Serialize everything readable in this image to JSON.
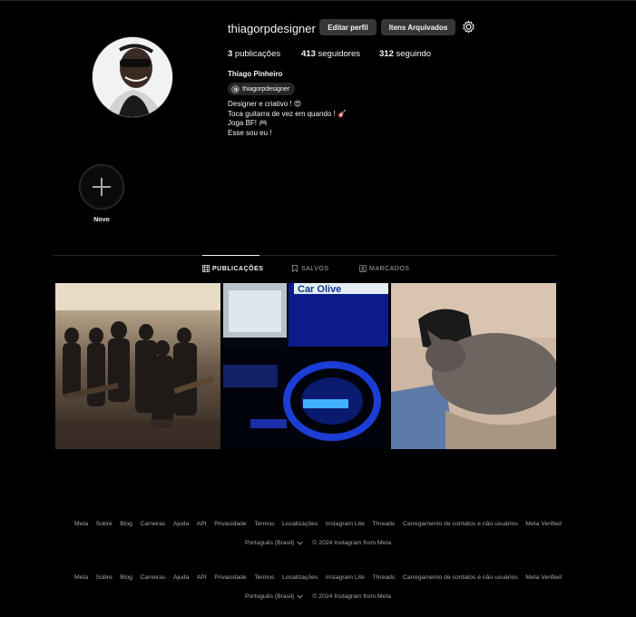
{
  "profile": {
    "username": "thiagorpdesigner",
    "edit_label": "Editar perfil",
    "archive_label": "Itens Arquivados",
    "stats": [
      {
        "count": "3",
        "label": " publicações"
      },
      {
        "count": "413",
        "label": " seguidores"
      },
      {
        "count": "312",
        "label": " seguindo"
      }
    ],
    "full_name": "Thiago Pinheiro",
    "threads_handle": "thiagorpdesigner",
    "bio": [
      "Designer e criativo ! 😍",
      "Toca guitarra de vez em quando ! 🎸",
      "Joga BF! 🎮",
      "Esse sou eu !"
    ]
  },
  "highlights": {
    "new_label": "Novo"
  },
  "tabs": [
    {
      "label": "PUBLICAÇÕES",
      "icon": "grid-icon",
      "active": true
    },
    {
      "label": "SALVOS",
      "icon": "bookmark-icon",
      "active": false
    },
    {
      "label": "MARCADOS",
      "icon": "tag-person-icon",
      "active": false
    }
  ],
  "footer": {
    "links": [
      "Meta",
      "Sobre",
      "Blog",
      "Carreiras",
      "Ajuda",
      "API",
      "Privacidade",
      "Termos",
      "Localizações",
      "Instagram Lite",
      "Threads",
      "Carregamento de contatos e não usuários",
      "Meta Verified"
    ],
    "language": "Português (Brasil)",
    "copyright": "© 2024 Instagram from Meta"
  },
  "colors": {
    "background": "#000000",
    "button_bg": "#363636",
    "muted_text": "#a8a8a8"
  }
}
